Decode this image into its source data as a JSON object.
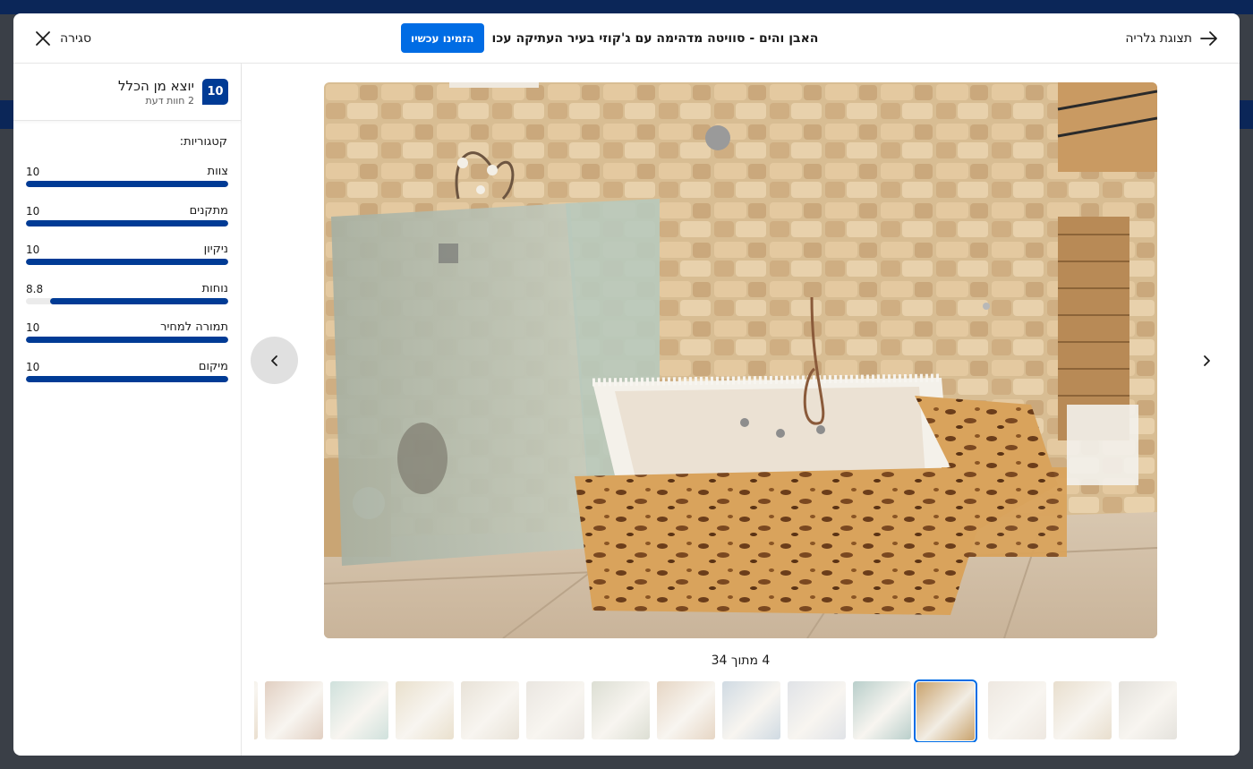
{
  "header": {
    "close_label": "סגירה",
    "title": "האבן והים - סוויטה מדהימה עם ג'קוזי בעיר העתיקה עכו",
    "book_label": "הזמינו עכשיו",
    "gallery_label": "תצוגת גלריה"
  },
  "score": {
    "value": "10",
    "word": "יוצא מן הכלל",
    "reviews": "2 חוות דעת"
  },
  "categories_title": "קטגוריות:",
  "categories": [
    {
      "name": "צוות",
      "score": "10",
      "fraction": 1.0
    },
    {
      "name": "מתקנים",
      "score": "10",
      "fraction": 1.0
    },
    {
      "name": "ניקיון",
      "score": "10",
      "fraction": 1.0
    },
    {
      "name": "נוחות",
      "score": "8.8",
      "fraction": 0.88
    },
    {
      "name": "תמורה למחיר",
      "score": "10",
      "fraction": 1.0
    },
    {
      "name": "מיקום",
      "score": "10",
      "fraction": 1.0
    }
  ],
  "counter": "4 מתוך 34",
  "colors": {
    "accent": "#006ce4",
    "score_blue": "#003b95",
    "bar_track": "#ebebeb"
  },
  "thumbnails": [
    {
      "tone": "#d9c5a8"
    },
    {
      "tone": "#c9a890"
    },
    {
      "tone": "#a9c9c0"
    },
    {
      "tone": "#d8c7a4"
    },
    {
      "tone": "#d6cbb8"
    },
    {
      "tone": "#d9d2c8"
    },
    {
      "tone": "#c0c4b0"
    },
    {
      "tone": "#d2b494"
    },
    {
      "tone": "#a9bccc"
    },
    {
      "tone": "#c7ccd4"
    },
    {
      "tone": "#7fa7a0"
    },
    {
      "tone": "#c9a36e",
      "active": true
    },
    {
      "tone": "#e0d5c8"
    },
    {
      "tone": "#d6c4a6"
    },
    {
      "tone": "#cfcac0"
    }
  ]
}
